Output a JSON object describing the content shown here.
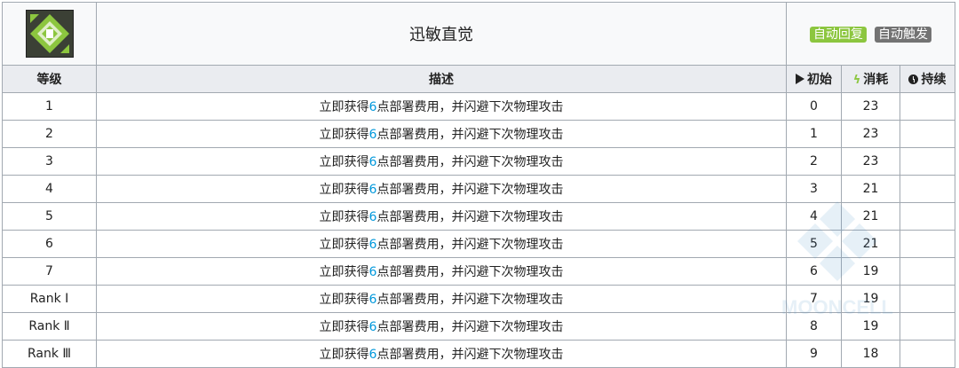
{
  "skill": {
    "name": "迅敏直觉",
    "tags": [
      {
        "label": "自动回复",
        "color": "#8cc63f"
      },
      {
        "label": "自动触发",
        "color": "#737373"
      }
    ]
  },
  "columns": {
    "level": "等级",
    "description": "描述",
    "initial": "初始",
    "cost": "消耗",
    "duration": "持续"
  },
  "desc_parts": {
    "before": "立即获得",
    "highlight": "6",
    "after": "点部署费用，并闪避下次物理攻击"
  },
  "rows": [
    {
      "level": "1",
      "initial": "0",
      "cost": "23",
      "duration": ""
    },
    {
      "level": "2",
      "initial": "1",
      "cost": "23",
      "duration": ""
    },
    {
      "level": "3",
      "initial": "2",
      "cost": "23",
      "duration": ""
    },
    {
      "level": "4",
      "initial": "3",
      "cost": "21",
      "duration": ""
    },
    {
      "level": "5",
      "initial": "4",
      "cost": "21",
      "duration": ""
    },
    {
      "level": "6",
      "initial": "5",
      "cost": "21",
      "duration": ""
    },
    {
      "level": "7",
      "initial": "6",
      "cost": "19",
      "duration": ""
    },
    {
      "level": "Rank Ⅰ",
      "initial": "7",
      "cost": "19",
      "duration": ""
    },
    {
      "level": "Rank Ⅱ",
      "initial": "8",
      "cost": "19",
      "duration": ""
    },
    {
      "level": "Rank Ⅲ",
      "initial": "9",
      "cost": "18",
      "duration": ""
    }
  ],
  "watermark": "MOONCELL",
  "icons": {
    "skill": "skill-icon",
    "initial": "play-icon",
    "cost": "bolt-icon",
    "duration": "clock-icon"
  }
}
